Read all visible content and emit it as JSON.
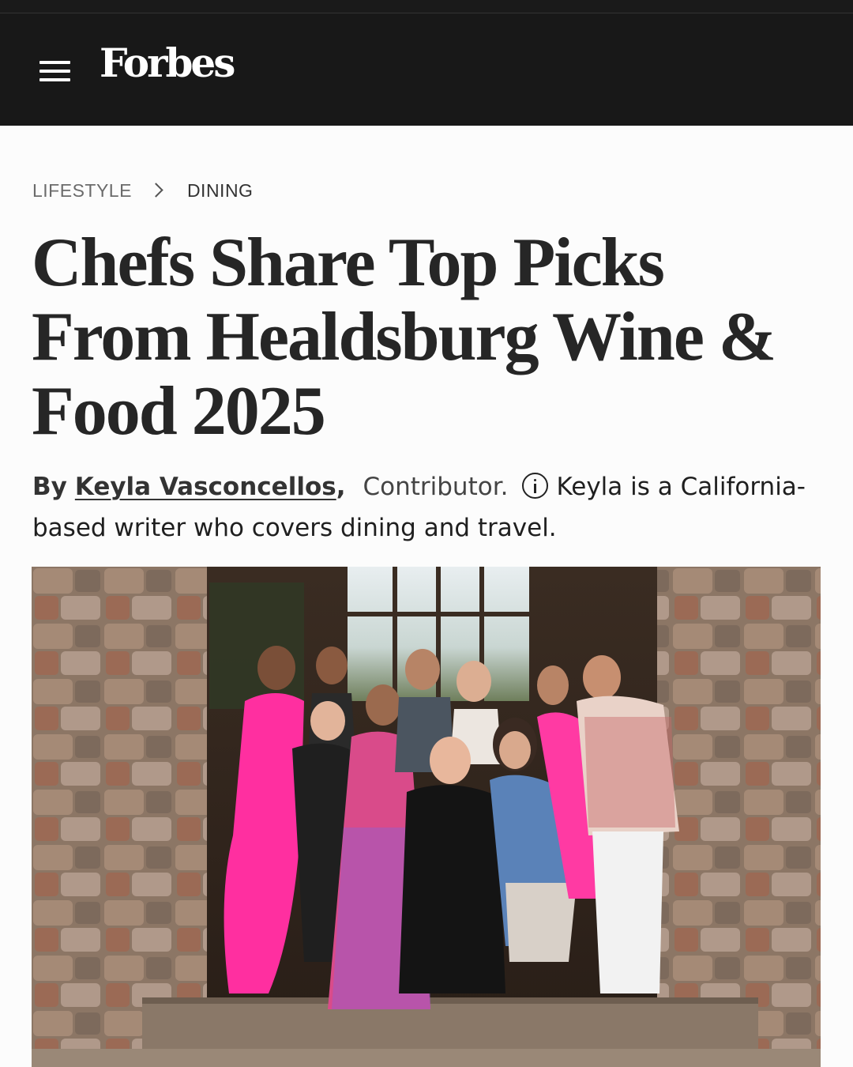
{
  "header": {
    "brand": "Forbes",
    "menu_icon": "hamburger-menu-icon",
    "background": "#181818"
  },
  "breadcrumb": {
    "section": "LIFESTYLE",
    "subsection": "DINING",
    "separator_icon": "chevron-right-icon"
  },
  "article": {
    "headline": "Chefs Share Top Picks From Healdsburg Wine & Food 2025",
    "byline": {
      "prefix": "By",
      "author": "Keyla Vasconcellos",
      "comma": ",",
      "role": "Contributor.",
      "info_icon": "info-circle-icon",
      "bio": "Keyla is a California-based writer who covers dining and travel."
    },
    "hero_image": {
      "icon": "photo-group-of-chefs"
    }
  }
}
